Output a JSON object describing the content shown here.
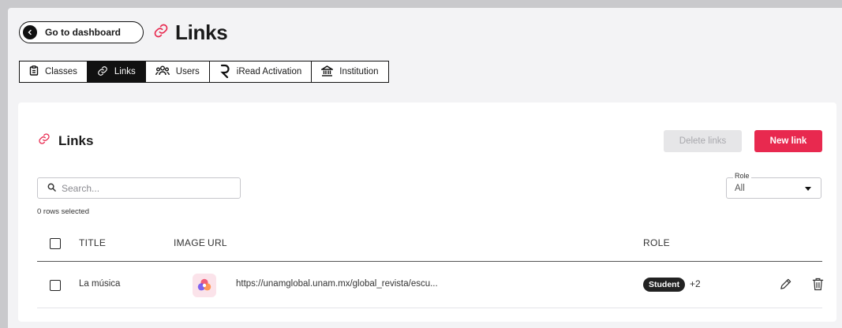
{
  "header": {
    "back_label": "Go to dashboard",
    "page_title": "Links"
  },
  "tabs": [
    {
      "label": "Classes",
      "icon": "clipboard-icon",
      "active": false
    },
    {
      "label": "Links",
      "icon": "link-icon",
      "active": true
    },
    {
      "label": "Users",
      "icon": "users-icon",
      "active": false
    },
    {
      "label": "iRead Activation",
      "icon": "iread-logo-icon",
      "active": false
    },
    {
      "label": "Institution",
      "icon": "institution-icon",
      "active": false
    }
  ],
  "card": {
    "title": "Links",
    "delete_label": "Delete links",
    "new_label": "New link",
    "search_placeholder": "Search...",
    "role_legend": "Role",
    "role_value": "All",
    "rows_selected": "0 rows selected"
  },
  "table": {
    "columns": {
      "title": "TITLE",
      "image": "IMAGE",
      "url": "URL",
      "role": "ROLE"
    },
    "rows": [
      {
        "title": "La música",
        "url": "https://unamglobal.unam.mx/global_revista/escu...",
        "role": "Student",
        "role_more": "+2"
      }
    ]
  },
  "colors": {
    "accent": "#e8294f",
    "dark": "#111111",
    "disabled_bg": "#e6e6e8"
  }
}
